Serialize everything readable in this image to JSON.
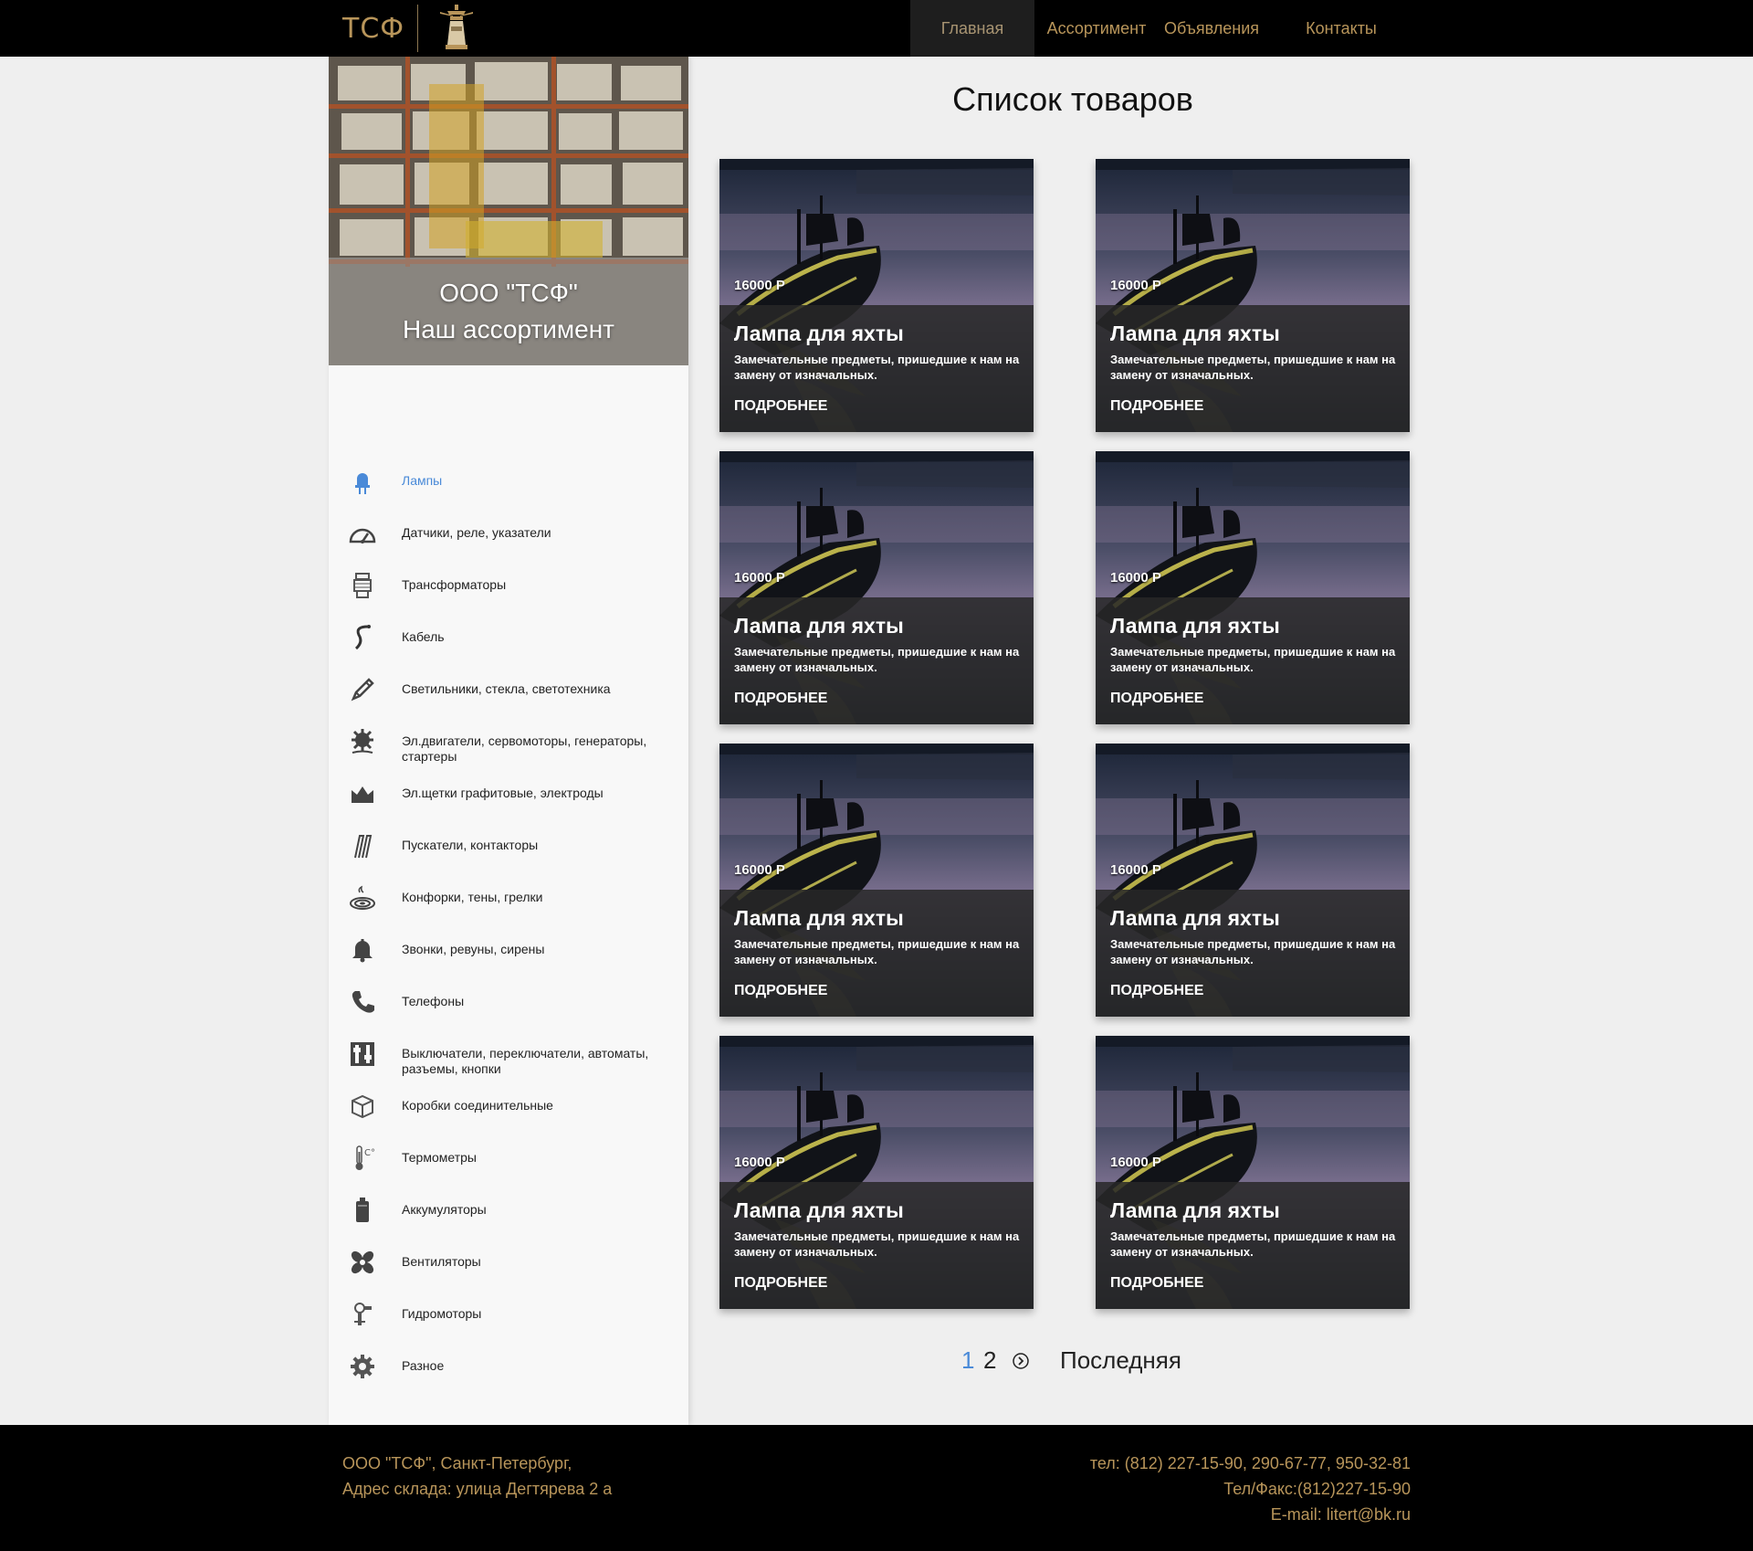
{
  "header": {
    "brand": "ТСФ",
    "nav": [
      {
        "label": "Главная"
      },
      {
        "label": "Ассортимент"
      },
      {
        "label": "Объявления"
      },
      {
        "label": "Контакты"
      }
    ]
  },
  "sidebar": {
    "hero_line1": "ООО \"ТСФ\"",
    "hero_line2": "Наш ассортимент",
    "categories": [
      {
        "label": "Лампы",
        "icon": "lamp-icon"
      },
      {
        "label": "Датчики, реле, указатели",
        "icon": "gauge-icon"
      },
      {
        "label": "Трансформаторы",
        "icon": "transformer-icon"
      },
      {
        "label": "Кабель",
        "icon": "cable-icon"
      },
      {
        "label": "Светильники, стекла, светотехника",
        "icon": "pencil-icon"
      },
      {
        "label": "Эл.двигатели, сервомоторы, генераторы, стартеры",
        "icon": "motor-icon"
      },
      {
        "label": "Эл.щетки графитовые, электроды",
        "icon": "brush-icon"
      },
      {
        "label": "Пускатели, контакторы",
        "icon": "contactor-icon"
      },
      {
        "label": "Конфорки, тены, грелки",
        "icon": "burner-icon"
      },
      {
        "label": "Звонки, ревуны, сирены",
        "icon": "bell-icon"
      },
      {
        "label": "Телефоны",
        "icon": "phone-icon"
      },
      {
        "label": "Выключатели, переключатели, автоматы, разъемы, кнопки",
        "icon": "switch-icon"
      },
      {
        "label": "Коробки соединительные",
        "icon": "box-icon"
      },
      {
        "label": "Термометры",
        "icon": "thermometer-icon"
      },
      {
        "label": "Аккумуляторы",
        "icon": "battery-icon"
      },
      {
        "label": "Вентиляторы",
        "icon": "fan-icon"
      },
      {
        "label": "Гидромоторы",
        "icon": "hydromotor-icon"
      },
      {
        "label": "Разное",
        "icon": "gear-icon"
      }
    ],
    "active_color": "#4a8ad8"
  },
  "main": {
    "title": "Список товаров",
    "products": [
      {
        "price": "16000 Р",
        "title": "Лампа для яхты",
        "desc": "Замечательные предметы, пришедшие к нам на замену от изначальных.",
        "more": "ПОДРОБНЕЕ"
      },
      {
        "price": "16000 Р",
        "title": "Лампа для яхты",
        "desc": "Замечательные предметы, пришедшие к нам на замену от изначальных.",
        "more": "ПОДРОБНЕЕ"
      },
      {
        "price": "16000 Р",
        "title": "Лампа для яхты",
        "desc": "Замечательные предметы, пришедшие к нам на замену от изначальных.",
        "more": "ПОДРОБНЕЕ"
      },
      {
        "price": "16000 Р",
        "title": "Лампа для яхты",
        "desc": "Замечательные предметы, пришедшие к нам на замену от изначальных.",
        "more": "ПОДРОБНЕЕ"
      },
      {
        "price": "16000 Р",
        "title": "Лампа для яхты",
        "desc": "Замечательные предметы, пришедшие к нам на замену от изначальных.",
        "more": "ПОДРОБНЕЕ"
      },
      {
        "price": "16000 Р",
        "title": "Лампа для яхты",
        "desc": "Замечательные предметы, пришедшие к нам на замену от изначальных.",
        "more": "ПОДРОБНЕЕ"
      },
      {
        "price": "16000 Р",
        "title": "Лампа для яхты",
        "desc": "Замечательные предметы, пришедшие к нам на замену от изначальных.",
        "more": "ПОДРОБНЕЕ"
      },
      {
        "price": "16000 Р",
        "title": "Лампа для яхты",
        "desc": "Замечательные предметы, пришедшие к нам на замену от изначальных.",
        "more": "ПОДРОБНЕЕ"
      }
    ],
    "pagination": {
      "page1": "1",
      "page2": "2",
      "last": "Последняя"
    }
  },
  "footer": {
    "left_line1": "ООО \"ТСФ\", Санкт-Петербург,",
    "left_line2": "Адрес склада: улица Дегтярева 2 а",
    "right_line1": "тел: (812) 227-15-90, 290-67-77, 950-32-81",
    "right_line2": "Тел/Факс:(812)227-15-90",
    "right_line3": "E-mail: litert@bk.ru"
  },
  "colors": {
    "gold": "#b8955a",
    "header_bg": "#000000",
    "page_bg": "#efefef"
  }
}
